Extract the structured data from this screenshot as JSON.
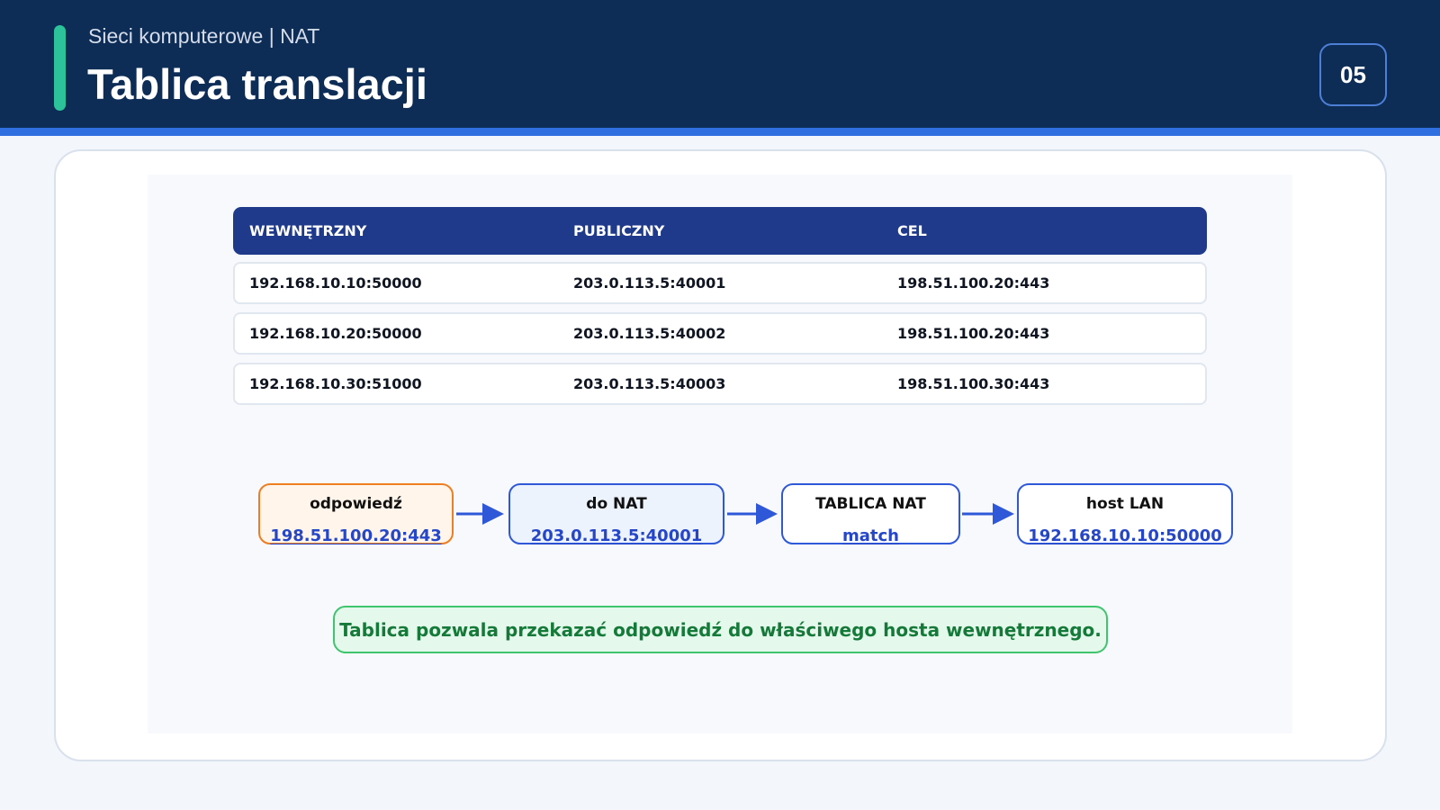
{
  "header": {
    "subtitle": "Sieci komputerowe | NAT",
    "title": "Tablica translacji",
    "page_number": "05"
  },
  "table": {
    "columns": [
      "WEWNĘTRZNY",
      "PUBLICZNY",
      "CEL"
    ],
    "rows": [
      [
        "192.168.10.10:50000",
        "203.0.113.5:40001",
        "198.51.100.20:443"
      ],
      [
        "192.168.10.20:50000",
        "203.0.113.5:40002",
        "198.51.100.20:443"
      ],
      [
        "192.168.10.30:51000",
        "203.0.113.5:40003",
        "198.51.100.30:443"
      ]
    ]
  },
  "flow": {
    "steps": [
      {
        "title": "odpowiedź",
        "value": "198.51.100.20:443"
      },
      {
        "title": "do NAT",
        "value": "203.0.113.5:40001"
      },
      {
        "title": "TABLICA NAT",
        "value": "match"
      },
      {
        "title": "host LAN",
        "value": "192.168.10.10:50000"
      }
    ]
  },
  "note": "Tablica pozwala przekazać odpowiedź do właściwego hosta wewnętrznego.",
  "colors": {
    "header_bg": "#0d2c56",
    "accent": "#2cc39a",
    "table_header": "#1f3a8a",
    "flow_border": "#2f58d8",
    "highlight_border": "#ef7d22",
    "note_border": "#3fc56e",
    "note_text": "#157a39"
  }
}
